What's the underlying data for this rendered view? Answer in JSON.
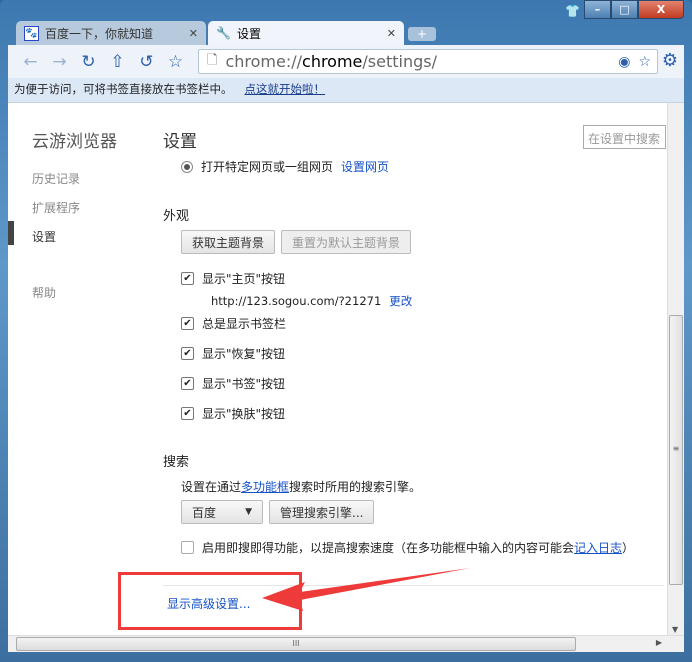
{
  "tabs": [
    {
      "label": "百度一下，你就知道",
      "icon": "baidu-paw-icon"
    },
    {
      "label": "设置",
      "icon": "wrench-icon"
    }
  ],
  "address": {
    "prefix": "chrome://",
    "host": "chrome",
    "path": "/settings/"
  },
  "bookmark_bar": {
    "text": "为便于访问，可将书签直接放在书签栏中。",
    "link": "点这就开始啦！"
  },
  "sidebar": {
    "title": "云游浏览器",
    "items": [
      "历史记录",
      "扩展程序",
      "设置",
      "帮助"
    ]
  },
  "main": {
    "title": "设置",
    "search_placeholder": "在设置中搜索",
    "startup": {
      "label": "打开特定网页或一组网页",
      "link": "设置网页"
    },
    "appearance": {
      "heading": "外观",
      "get_theme": "获取主题背景",
      "reset_theme": "重置为默认主题背景",
      "show_home": "显示\"主页\"按钮",
      "home_url": "http://123.sogou.com/?21271",
      "change": "更改",
      "show_bookmarks": "总是显示书签栏",
      "show_restore": "显示\"恢复\"按钮",
      "show_bookmark_btn": "显示\"书签\"按钮",
      "show_skin": "显示\"换肤\"按钮"
    },
    "search": {
      "heading": "搜索",
      "desc_pre": "设置在通过",
      "desc_link": "多功能框",
      "desc_post": "搜索时所用的搜索引擎。",
      "engine": "百度",
      "manage": "管理搜索引擎...",
      "instant_label": "启用即搜即得功能，以提高搜索速度（在多功能框中输入的内容可能会",
      "instant_link": "记入日志",
      "instant_close": "）"
    },
    "advanced": "显示高级设置..."
  },
  "colors": {
    "annotation": "#ef3a3a",
    "link": "#1551c6"
  }
}
